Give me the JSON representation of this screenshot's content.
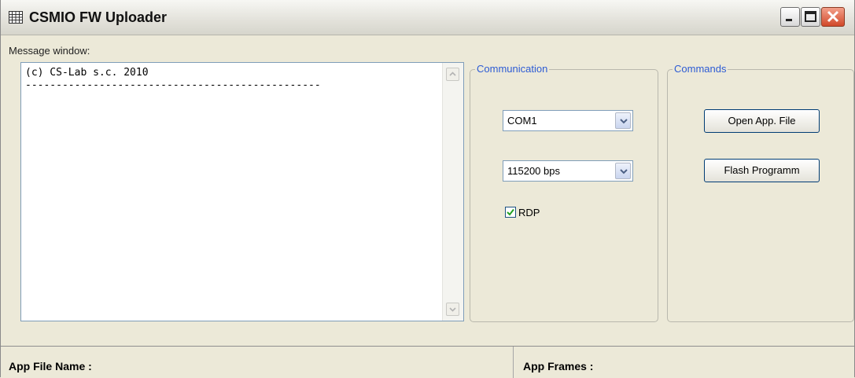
{
  "window": {
    "title": "CSMIO FW Uploader",
    "icon": "app-grid-icon"
  },
  "message_window": {
    "label": "Message window:",
    "lines": [
      "(c) CS-Lab s.c. 2010",
      "------------------------------------------------"
    ]
  },
  "communication": {
    "legend": "Communication",
    "port": "COM1",
    "baud": "115200 bps",
    "rdp_label": "RDP",
    "rdp_checked": true
  },
  "commands": {
    "legend": "Commands",
    "open_label": "Open App. File",
    "flash_label": "Flash Programm"
  },
  "status": {
    "file_label": "App File Name :",
    "frames_label": "App Frames :"
  },
  "colors": {
    "legend": "#2c5bd4",
    "close_button": "#d1492a"
  }
}
